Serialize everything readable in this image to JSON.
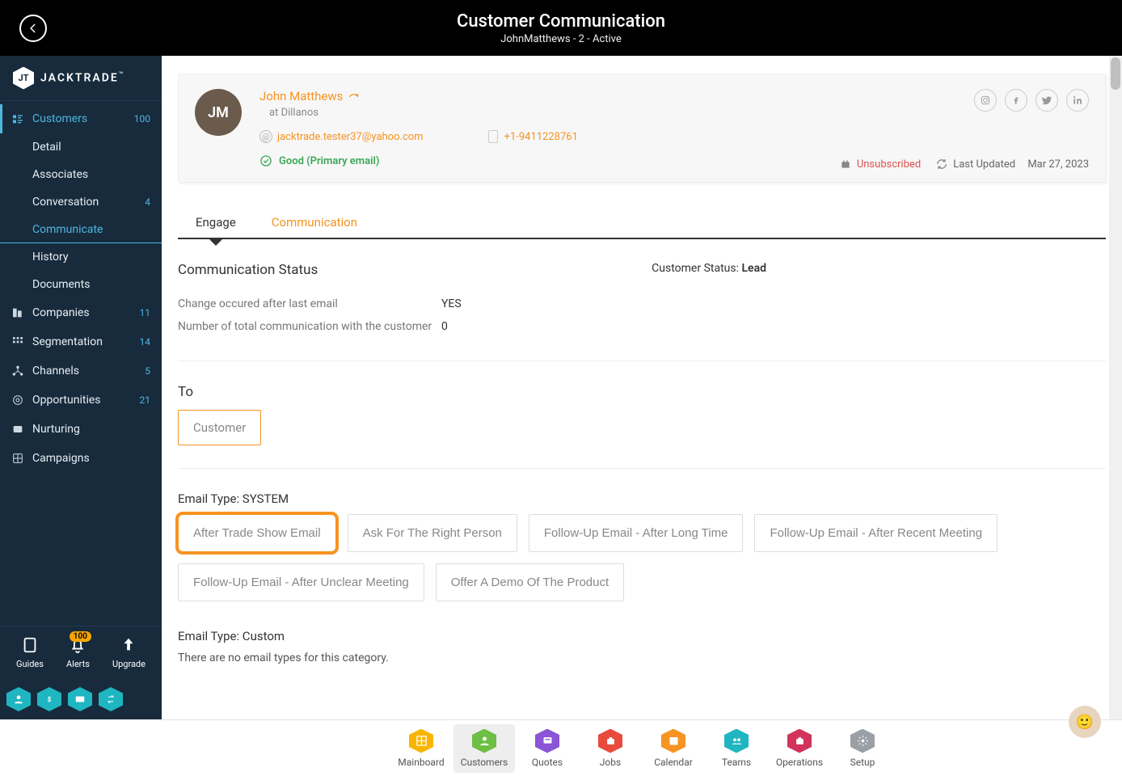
{
  "header": {
    "title": "Customer Communication",
    "subtitle": "JohnMatthews - 2 - Active"
  },
  "brand": {
    "name": "JACKTRADE",
    "tm": "™"
  },
  "sidebar": {
    "items": [
      {
        "label": "Customers",
        "count": "100",
        "active": true
      },
      {
        "label": "Companies",
        "count": "11"
      },
      {
        "label": "Segmentation",
        "count": "14"
      },
      {
        "label": "Channels",
        "count": "5"
      },
      {
        "label": "Opportunities",
        "count": "21"
      },
      {
        "label": "Nurturing",
        "count": ""
      },
      {
        "label": "Campaigns",
        "count": ""
      }
    ],
    "subitems": [
      {
        "label": "Detail"
      },
      {
        "label": "Associates"
      },
      {
        "label": "Conversation",
        "count": "4"
      },
      {
        "label": "Communicate",
        "active": true
      },
      {
        "label": "History"
      },
      {
        "label": "Documents"
      }
    ],
    "bottom": {
      "guides": "Guides",
      "alerts": "Alerts",
      "alerts_badge": "100",
      "upgrade": "Upgrade"
    }
  },
  "customer": {
    "name": "John Matthews",
    "at_prefix": "at",
    "company": "Dillanos",
    "email": "jacktrade.tester37@yahoo.com",
    "phone": "+1-9411228761",
    "email_status": "Good (Primary email)",
    "subscription": "Unsubscribed",
    "updated_prefix": "Last Updated",
    "updated": "Mar 27, 2023",
    "initials": "JM"
  },
  "tabs": {
    "engage": "Engage",
    "communication": "Communication"
  },
  "comm": {
    "status_heading": "Communication Status",
    "customer_status_label": "Customer Status:",
    "customer_status_value": "Lead",
    "rows": [
      {
        "label": "Change occured after last email",
        "value": "YES"
      },
      {
        "label": "Number of total communication with the customer",
        "value": "0"
      }
    ],
    "to_label": "To",
    "to_chip": "Customer",
    "email_type_label_system": "Email Type: SYSTEM",
    "system_types": [
      "After Trade Show Email",
      "Ask For The Right Person",
      "Follow-Up Email - After Long Time",
      "Follow-Up Email - After Recent Meeting",
      "Follow-Up Email - After Unclear Meeting",
      "Offer A Demo Of The Product"
    ],
    "email_type_label_custom": "Email Type: Custom",
    "custom_empty": "There are no email types for this category."
  },
  "bottombar": {
    "items": [
      {
        "label": "Mainboard",
        "color": "#f7b500"
      },
      {
        "label": "Customers",
        "color": "#6cbf43",
        "active": true
      },
      {
        "label": "Quotes",
        "color": "#8a55d6"
      },
      {
        "label": "Jobs",
        "color": "#e84b3c"
      },
      {
        "label": "Calendar",
        "color": "#f79321"
      },
      {
        "label": "Teams",
        "color": "#1fb6c1"
      },
      {
        "label": "Operations",
        "color": "#d1335b"
      },
      {
        "label": "Setup",
        "color": "#9aa0a6"
      }
    ]
  }
}
